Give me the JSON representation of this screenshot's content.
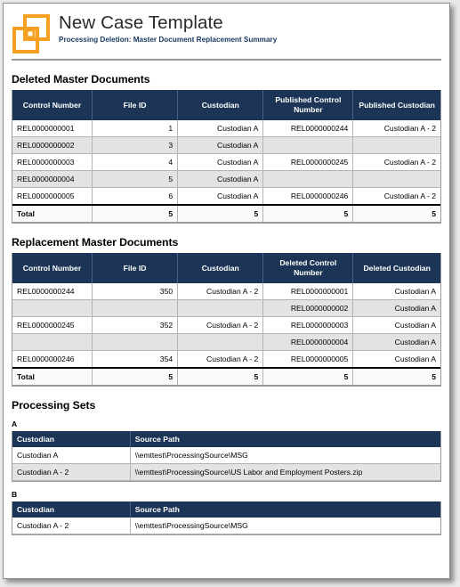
{
  "header": {
    "title": "New Case Template",
    "subtitle": "Processing Deletion: Master Document Replacement Summary",
    "logo_icon": "two-overlapping-squares-logo",
    "logo_color": "#F5A021"
  },
  "colors": {
    "table_header_bg": "#1C3557",
    "table_header_text": "#FFFFFF",
    "alt_row_bg": "#E3E3E3",
    "subtitle_text": "#1B3B66",
    "rule": "#9A9A9A"
  },
  "sections": [
    {
      "id": "deleted-master-documents",
      "title": "Deleted Master Documents",
      "columns": [
        "Control Number",
        "File ID",
        "Custodian",
        "Published Control Number",
        "Published Custodian"
      ],
      "rows": [
        [
          "REL0000000001",
          "1",
          "Custodian A",
          "REL0000000244",
          "Custodian A - 2"
        ],
        [
          "REL0000000002",
          "3",
          "Custodian A",
          "",
          ""
        ],
        [
          "REL0000000003",
          "4",
          "Custodian A",
          "REL0000000245",
          "Custodian A - 2"
        ],
        [
          "REL0000000004",
          "5",
          "Custodian A",
          "",
          ""
        ],
        [
          "REL0000000005",
          "6",
          "Custodian A",
          "REL0000000246",
          "Custodian A - 2"
        ]
      ],
      "total_label": "Total",
      "totals": [
        "5",
        "5",
        "5",
        "5"
      ]
    },
    {
      "id": "replacement-master-documents",
      "title": "Replacement Master Documents",
      "columns": [
        "Control Number",
        "File ID",
        "Custodian",
        "Deleted Control Number",
        "Deleted Custodian"
      ],
      "rows": [
        [
          "REL0000000244",
          "350",
          "Custodian A - 2",
          "REL0000000001",
          "Custodian A"
        ],
        [
          "",
          "",
          "",
          "REL0000000002",
          "Custodian A"
        ],
        [
          "REL0000000245",
          "352",
          "Custodian A - 2",
          "REL0000000003",
          "Custodian A"
        ],
        [
          "",
          "",
          "",
          "REL0000000004",
          "Custodian A"
        ],
        [
          "REL0000000246",
          "354",
          "Custodian A - 2",
          "REL0000000005",
          "Custodian A"
        ]
      ],
      "total_label": "Total",
      "totals": [
        "5",
        "5",
        "5",
        "5"
      ]
    }
  ],
  "processing_sets": {
    "title": "Processing Sets",
    "columns": [
      "Custodian",
      "Source Path"
    ],
    "sets": [
      {
        "name": "A",
        "rows": [
          [
            "Custodian A",
            "\\\\emttest\\ProcessingSource\\MSG"
          ],
          [
            "Custodian A - 2",
            "\\\\emttest\\ProcessingSource\\US Labor and Employment Posters.zip"
          ]
        ]
      },
      {
        "name": "B",
        "rows": [
          [
            "Custodian A - 2",
            "\\\\emttest\\ProcessingSource\\MSG"
          ]
        ]
      }
    ]
  }
}
